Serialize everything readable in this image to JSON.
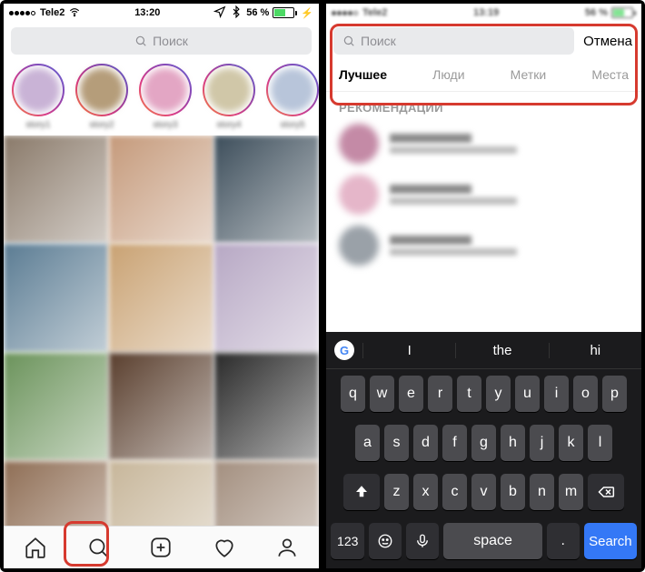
{
  "left": {
    "status": {
      "carrier": "Tele2",
      "wifi": "wifi",
      "time": "13:20",
      "nav": "nav",
      "bt": "bt",
      "battery_pct": "56 %"
    },
    "search_placeholder": "Поиск",
    "stories": [
      {
        "label": "story1",
        "bg": "#c9b3d6"
      },
      {
        "label": "story2",
        "bg": "#b59d7a"
      },
      {
        "label": "story3",
        "bg": "#e3a6c4"
      },
      {
        "label": "story4",
        "bg": "#d0c7a8"
      },
      {
        "label": "story5",
        "bg": "#b8c5da"
      }
    ],
    "grid_colors": [
      "#8a7a6a",
      "#c59a7b",
      "#3d4e5b",
      "#5b7c93",
      "#c9a273",
      "#b7a8c4",
      "#6b935b",
      "#5a3f2e",
      "#2a2a2a",
      "#8f6e55",
      "#c7b69a",
      "#a38f7f"
    ],
    "tabs": [
      "home",
      "search",
      "add",
      "activity",
      "profile"
    ]
  },
  "right": {
    "status": {
      "carrier": "Tele2",
      "time": "13:19",
      "battery_pct": "56 %"
    },
    "search_placeholder": "Поиск",
    "cancel": "Отмена",
    "tabs": [
      "Лучшее",
      "Люди",
      "Метки",
      "Места"
    ],
    "active_tab": 0,
    "section": "РЕКОМЕНДАЦИИ",
    "recommendations": [
      {
        "avatar": "#c48aa6"
      },
      {
        "avatar": "#e5b6c9"
      },
      {
        "avatar": "#9aa1a8"
      }
    ],
    "keyboard": {
      "suggestions": [
        "I",
        "the",
        "hi"
      ],
      "rows": [
        [
          "q",
          "w",
          "e",
          "r",
          "t",
          "y",
          "u",
          "i",
          "o",
          "p"
        ],
        [
          "a",
          "s",
          "d",
          "f",
          "g",
          "h",
          "j",
          "k",
          "l"
        ],
        [
          "z",
          "x",
          "c",
          "v",
          "b",
          "n",
          "m"
        ]
      ],
      "num": "123",
      "space": "space",
      "search": "Search"
    }
  }
}
